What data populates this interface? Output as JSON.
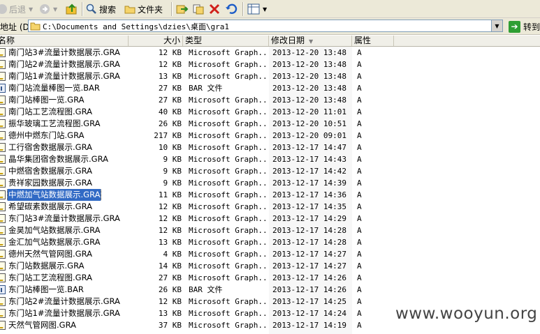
{
  "toolbar": {
    "back_label": "后退",
    "search_label": "搜索",
    "folders_label": "文件夹"
  },
  "address": {
    "label": "地址 (D)",
    "path": "C:\\Documents and Settings\\dzies\\桌面\\gra1",
    "go_label": "转到"
  },
  "columns": {
    "name": "名称",
    "size": "大小",
    "type": "类型",
    "modified": "修改日期",
    "attributes": "属性"
  },
  "files": [
    {
      "name": "南门站3#流量计数据展示.GRA",
      "size": "12 KB",
      "type": "Microsoft Graph...",
      "date": "2013-12-20 13:48",
      "attr": "A",
      "icon": "gra-file-icon"
    },
    {
      "name": "南门站2#流量计数据展示.GRA",
      "size": "12 KB",
      "type": "Microsoft Graph...",
      "date": "2013-12-20 13:48",
      "attr": "A",
      "icon": "gra-file-icon"
    },
    {
      "name": "南门站1#流量计数据展示.GRA",
      "size": "13 KB",
      "type": "Microsoft Graph...",
      "date": "2013-12-20 13:48",
      "attr": "A",
      "icon": "gra-file-icon"
    },
    {
      "name": "南门站流量棒图一览.BAR",
      "size": "27 KB",
      "type": "BAR 文件",
      "date": "2013-12-20 13:48",
      "attr": "A",
      "icon": "bar-file-icon"
    },
    {
      "name": "南门站棒图一览.GRA",
      "size": "27 KB",
      "type": "Microsoft Graph...",
      "date": "2013-12-20 13:48",
      "attr": "A",
      "icon": "gra-file-icon"
    },
    {
      "name": "南门站工艺流程图.GRA",
      "size": "40 KB",
      "type": "Microsoft Graph...",
      "date": "2013-12-20 11:01",
      "attr": "A",
      "icon": "gra-file-icon"
    },
    {
      "name": "振华玻璃工艺流程图.GRA",
      "size": "26 KB",
      "type": "Microsoft Graph...",
      "date": "2013-12-20 10:51",
      "attr": "A",
      "icon": "gra-file-icon"
    },
    {
      "name": "德州中燃东门站.GRA",
      "size": "217 KB",
      "type": "Microsoft Graph...",
      "date": "2013-12-20 09:01",
      "attr": "A",
      "icon": "gra-file-icon"
    },
    {
      "name": "工行宿舍数据展示.GRA",
      "size": "10 KB",
      "type": "Microsoft Graph...",
      "date": "2013-12-17 14:47",
      "attr": "A",
      "icon": "gra-file-icon"
    },
    {
      "name": "晶华集团宿舍数据展示.GRA",
      "size": "9 KB",
      "type": "Microsoft Graph...",
      "date": "2013-12-17 14:43",
      "attr": "A",
      "icon": "gra-file-icon"
    },
    {
      "name": "中燃宿舍数据展示.GRA",
      "size": "9 KB",
      "type": "Microsoft Graph...",
      "date": "2013-12-17 14:42",
      "attr": "A",
      "icon": "gra-file-icon"
    },
    {
      "name": "贵祥家园数据展示.GRA",
      "size": "9 KB",
      "type": "Microsoft Graph...",
      "date": "2013-12-17 14:39",
      "attr": "A",
      "icon": "gra-file-icon"
    },
    {
      "name": "中燃加气站数据展示.GRA",
      "size": "11 KB",
      "type": "Microsoft Graph...",
      "date": "2013-12-17 14:36",
      "attr": "A",
      "icon": "gra-file-icon",
      "selected": true
    },
    {
      "name": "希望碳素数据展示.GRA",
      "size": "12 KB",
      "type": "Microsoft Graph...",
      "date": "2013-12-17 14:35",
      "attr": "A",
      "icon": "gra-file-icon"
    },
    {
      "name": "东门站3#流量计数据展示.GRA",
      "size": "12 KB",
      "type": "Microsoft Graph...",
      "date": "2013-12-17 14:29",
      "attr": "A",
      "icon": "gra-file-icon"
    },
    {
      "name": "金昊加气站数据展示.GRA",
      "size": "12 KB",
      "type": "Microsoft Graph...",
      "date": "2013-12-17 14:28",
      "attr": "A",
      "icon": "gra-file-icon"
    },
    {
      "name": "金汇加气站数据展示.GRA",
      "size": "13 KB",
      "type": "Microsoft Graph...",
      "date": "2013-12-17 14:28",
      "attr": "A",
      "icon": "gra-file-icon"
    },
    {
      "name": "德州天然气管网图.GRA",
      "size": "4 KB",
      "type": "Microsoft Graph...",
      "date": "2013-12-17 14:27",
      "attr": "A",
      "icon": "gra-file-icon"
    },
    {
      "name": "东门站数据展示.GRA",
      "size": "14 KB",
      "type": "Microsoft Graph...",
      "date": "2013-12-17 14:27",
      "attr": "A",
      "icon": "gra-file-icon"
    },
    {
      "name": "东门站工艺流程图.GRA",
      "size": "27 KB",
      "type": "Microsoft Graph...",
      "date": "2013-12-17 14:26",
      "attr": "A",
      "icon": "gra-file-icon"
    },
    {
      "name": "东门站棒图一览.BAR",
      "size": "26 KB",
      "type": "BAR 文件",
      "date": "2013-12-17 14:26",
      "attr": "A",
      "icon": "bar-file-icon"
    },
    {
      "name": "东门站2#流量计数据展示.GRA",
      "size": "12 KB",
      "type": "Microsoft Graph...",
      "date": "2013-12-17 14:25",
      "attr": "A",
      "icon": "gra-file-icon"
    },
    {
      "name": "东门站1#流量计数据展示.GRA",
      "size": "13 KB",
      "type": "Microsoft Graph...",
      "date": "2013-12-17 14:24",
      "attr": "A",
      "icon": "gra-file-icon"
    },
    {
      "name": "天然气管网图.GRA",
      "size": "37 KB",
      "type": "Microsoft Graph...",
      "date": "2013-12-17 14:19",
      "attr": "A",
      "icon": "gra-file-icon"
    }
  ],
  "watermark": "www.wooyun.org"
}
